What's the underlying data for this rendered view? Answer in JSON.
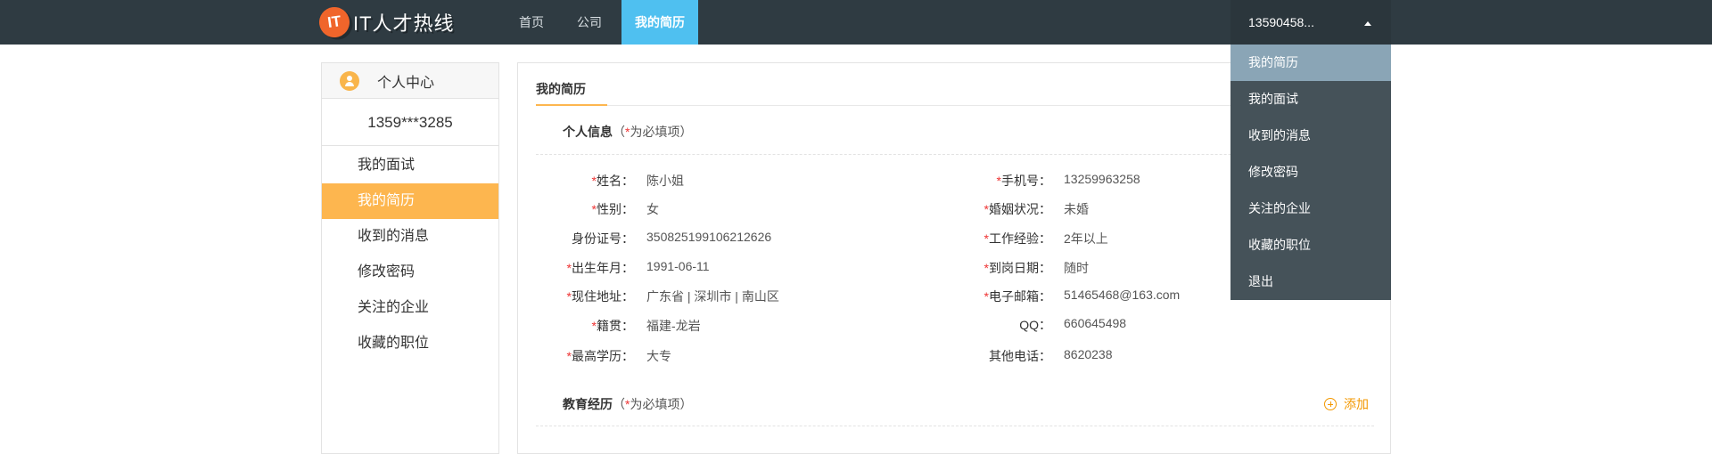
{
  "header": {
    "logo_badge": "IT",
    "logo_text": "IT人才热线",
    "nav": [
      "首页",
      "公司",
      "我的简历"
    ],
    "user_label": "13590458..."
  },
  "dropdown": [
    "我的简历",
    "我的面试",
    "收到的消息",
    "修改密码",
    "关注的企业",
    "收藏的职位",
    "退出"
  ],
  "sidebar": {
    "title": "个人中心",
    "user": "1359***3285",
    "items": [
      "我的面试",
      "我的简历",
      "收到的消息",
      "修改密码",
      "关注的企业",
      "收藏的职位"
    ]
  },
  "main": {
    "tab": "我的简历",
    "personal": {
      "title": "个人信息",
      "note_prefix": "（",
      "note_star": "*",
      "note_suffix": "为必填项）",
      "left": [
        {
          "required": true,
          "label": "姓名：",
          "value": "陈小姐"
        },
        {
          "required": true,
          "label": "性别：",
          "value": "女"
        },
        {
          "required": false,
          "label": "身份证号：",
          "value": "350825199106212626"
        },
        {
          "required": true,
          "label": "出生年月：",
          "value": "1991-06-11"
        },
        {
          "required": true,
          "label": "现住地址：",
          "value": "广东省 | 深圳市 | 南山区"
        },
        {
          "required": true,
          "label": "籍贯：",
          "value": "福建-龙岩"
        },
        {
          "required": true,
          "label": "最高学历：",
          "value": "大专"
        }
      ],
      "right": [
        {
          "required": true,
          "label": "手机号：",
          "value": "13259963258"
        },
        {
          "required": true,
          "label": "婚姻状况：",
          "value": "未婚"
        },
        {
          "required": true,
          "label": "工作经验：",
          "value": "2年以上"
        },
        {
          "required": true,
          "label": "到岗日期：",
          "value": "随时"
        },
        {
          "required": true,
          "label": "电子邮箱：",
          "value": "51465468@163.com"
        },
        {
          "required": false,
          "label": "QQ：",
          "value": "660645498"
        },
        {
          "required": false,
          "label": "其他电话：",
          "value": "8620238"
        }
      ]
    },
    "education": {
      "title": "教育经历",
      "note_prefix": "（",
      "note_star": "*",
      "note_suffix": "为必填项）",
      "add_label": "添加"
    }
  },
  "colors": {
    "topbar": "#2f3b42",
    "nav_active": "#4fc0f0",
    "accent": "#fdb64f",
    "dropdown_bg": "#455259",
    "dropdown_active": "#8aa5b6"
  }
}
